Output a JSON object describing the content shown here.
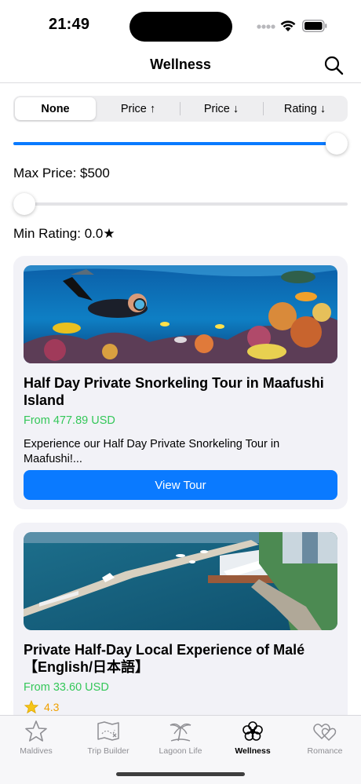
{
  "status_bar": {
    "time": "21:49"
  },
  "nav": {
    "title": "Wellness"
  },
  "sort": {
    "options": [
      "None",
      "Price ↑",
      "Price ↓",
      "Rating ↓"
    ],
    "selected": "None"
  },
  "filters": {
    "max_price_label": "Max Price: $500",
    "max_price_value": 500,
    "max_price_fraction": 1.0,
    "min_rating_label": "Min Rating: 0.0★",
    "min_rating_value": 0.0,
    "min_rating_fraction": 0.0
  },
  "tours": [
    {
      "title": "Half Day Private Snorkeling Tour in Maafushi Island",
      "price": "From 477.89 USD",
      "description": "Experience our Half Day Private Snorkeling Tour in Maafushi!...",
      "button_label": "View Tour"
    },
    {
      "title": "Private Half-Day Local Experience of Malé 【English/日本語】",
      "price": "From 33.60 USD",
      "rating": "4.3"
    }
  ],
  "tab_bar": {
    "tabs": [
      {
        "label": "Maldives",
        "icon": "star-icon"
      },
      {
        "label": "Trip Builder",
        "icon": "map-icon"
      },
      {
        "label": "Lagoon Life",
        "icon": "palm-tree-icon"
      },
      {
        "label": "Wellness",
        "icon": "flower-icon"
      },
      {
        "label": "Romance",
        "icon": "hearts-icon"
      }
    ],
    "active": "Wellness"
  },
  "colors": {
    "accent": "#0a7aff",
    "price_green": "#34c759",
    "rating_orange": "#f0a000",
    "card_background": "#f2f2f7"
  }
}
